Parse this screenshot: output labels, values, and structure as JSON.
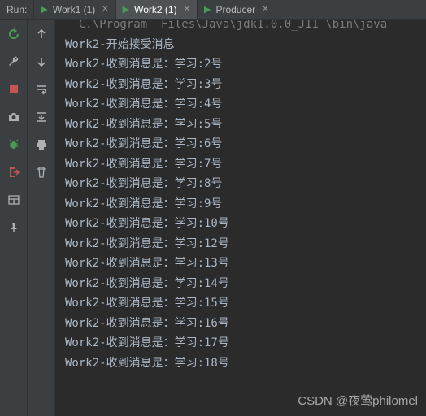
{
  "header": {
    "run_label": "Run:",
    "tabs": [
      {
        "icon": "play",
        "label": "Work1 (1)",
        "active": false
      },
      {
        "icon": "play",
        "label": "Work2 (1)",
        "active": true
      },
      {
        "icon": "play",
        "label": "Producer",
        "active": false
      }
    ]
  },
  "left_gutter": [
    "rerun-green",
    "wrench",
    "stop-red",
    "camera",
    "bug-green",
    "exit",
    "layout",
    "pin"
  ],
  "mid_gutter": [
    "arrow-up",
    "arrow-down",
    "soft-wrap",
    "scroll-to-end",
    "print",
    "trash"
  ],
  "console": {
    "first_line": "  C.\\Program  Files\\Java\\jdk1.0.0_J11 \\bin\\java",
    "lines": [
      "Work2-开始接受消息",
      "Work2-收到消息是：学习:2号",
      "Work2-收到消息是：学习:3号",
      "Work2-收到消息是：学习:4号",
      "Work2-收到消息是：学习:5号",
      "Work2-收到消息是：学习:6号",
      "Work2-收到消息是：学习:7号",
      "Work2-收到消息是：学习:8号",
      "Work2-收到消息是：学习:9号",
      "Work2-收到消息是：学习:10号",
      "Work2-收到消息是：学习:12号",
      "Work2-收到消息是：学习:13号",
      "Work2-收到消息是：学习:14号",
      "Work2-收到消息是：学习:15号",
      "Work2-收到消息是：学习:16号",
      "Work2-收到消息是：学习:17号",
      "Work2-收到消息是：学习:18号"
    ]
  },
  "watermark": "CSDN @夜莺philomel"
}
